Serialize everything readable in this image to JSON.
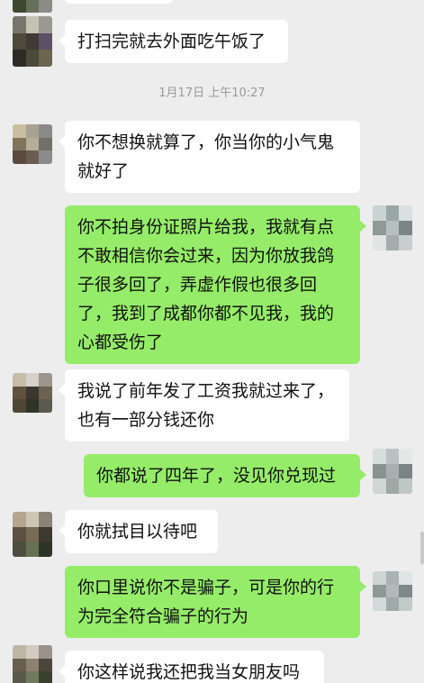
{
  "conversation": {
    "timestamp": "1月17日 上午10:27",
    "messages": [
      {
        "side": "recv",
        "text": "打扫完就去外面吃午饭了"
      },
      {
        "side": "recv",
        "text": "你不想换就算了，你当你的小气鬼就好了"
      },
      {
        "side": "sent",
        "text": "你不拍身份证照片给我，我就有点不敢相信你会过来，因为你放我鸽子很多回了，弄虚作假也很多回了，我到了成都你都不见我，我的心都受伤了"
      },
      {
        "side": "recv",
        "text": "我说了前年发了工资我就过来了，也有一部分钱还你"
      },
      {
        "side": "sent",
        "text": "你都说了四年了，没见你兑现过"
      },
      {
        "side": "recv",
        "text": "你就拭目以待吧"
      },
      {
        "side": "sent",
        "text": "你口里说你不是骗子，可是你的行为完全符合骗子的行为"
      },
      {
        "side": "recv",
        "text": "你这样说我还把我当女朋友吗"
      }
    ]
  },
  "colors": {
    "background": "#ededed",
    "sent_bubble": "#95ec69",
    "recv_bubble": "#ffffff",
    "timestamp": "#9a9a9a"
  },
  "avatars": {
    "contact_icon": "pixelated-avatar-icon",
    "self_icon": "pixelated-avatar-icon"
  }
}
